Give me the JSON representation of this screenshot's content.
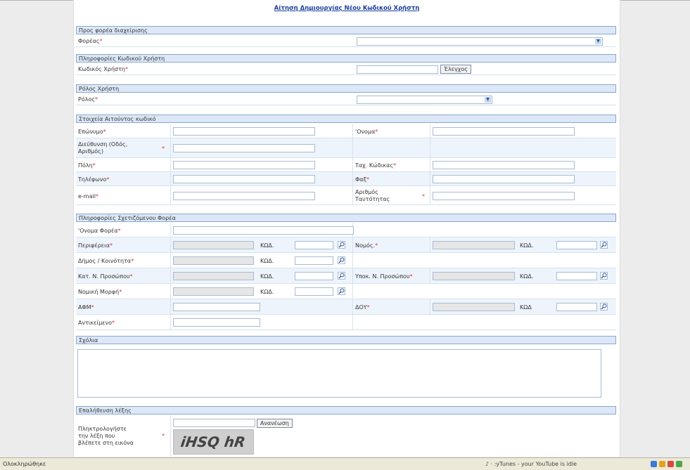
{
  "title": "Αίτηση Δημιουργίας Νέου Κωδικού Χρήστη",
  "required_mark": "*",
  "sections": {
    "foreas": "Προς φορέα διαχείρισης",
    "info": "Πληροφορίες Κωδικού Χρήστη",
    "rolos": "Ρόλος Χρήστη",
    "aitountos": "Στοιχεία Αιτούντος κωδικό",
    "sxetiz": "Πληροφορίες Σχετιζόμενου Φορέα",
    "sxolia": "Σχόλια",
    "epal": "Επαλήθευση λέξης"
  },
  "labels": {
    "foreas": "Φορέας",
    "kodikos": "Κωδικός Χρήστη",
    "rolos": "Ρόλος",
    "eponymo": "Επώνυμο",
    "onoma": "'Ονομα",
    "dieuthynsi": "Διεύθυνση (Οδός, Αριθμός)",
    "poli": "Πόλη",
    "tk": "Ταχ. Κώδικας",
    "tilefono": "Τηλέφωνο",
    "fax": "Φαξ",
    "email": "e-mail",
    "taytotita": "Αριθμός Ταυτότητας",
    "onoma_forea": "'Ονομα Φορέα",
    "perifereia": "Περιφέρεια",
    "nomos": "Νομός.",
    "dimos": "Δήμος / Κοινότητα",
    "kat_np": "Κατ. Ν. Προσώπου",
    "ypok_np": "Υποκ. Ν. Προσώπου",
    "nomiki": "Νομική Μορφή",
    "afm": "ΑΦΜ",
    "doy": "ΔΟΥ",
    "antikeimeno": "Αντικείμενο",
    "captcha_prompt": "Πληκτρολογήστε την λέξη που βλέπετε στη εικόνα",
    "kwd": "ΚΩΔ.",
    "kwd_nodot": "ΚΩΔ"
  },
  "buttons": {
    "elegxos": "Έλεγχος",
    "ananeosi": "Ανανέωση"
  },
  "captcha_text": "iHSQ hR",
  "statusbar": {
    "status": "Ολοκληρώθηκε",
    "tray": "♪ · :yTunes - your YouTube is idle"
  }
}
